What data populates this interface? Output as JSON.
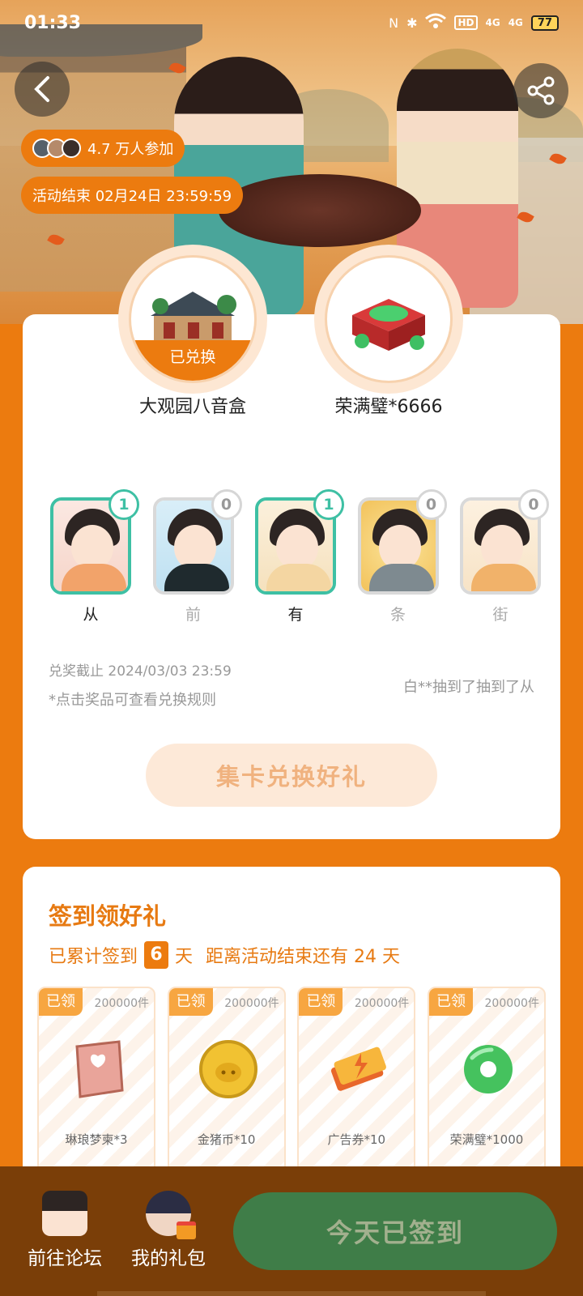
{
  "status_bar": {
    "time": "01:33",
    "nfc": "N",
    "bluetooth": "✱",
    "wifi": "wifi",
    "hd": "HD",
    "signal1": "4G",
    "signal2": "4G",
    "battery": "77"
  },
  "hero": {
    "participants": "4.7 万人参加",
    "end_time": "活动结束 02月24日 23:59:59"
  },
  "prizes": [
    {
      "name": "大观园八音盒",
      "status": "已兑换"
    },
    {
      "name": "荣满璧*6666",
      "status": ""
    }
  ],
  "cards": [
    {
      "label": "从",
      "count": "1",
      "collected": true,
      "cloth": "#f2a36a"
    },
    {
      "label": "前",
      "count": "0",
      "collected": false,
      "cloth": "#1f2a2e"
    },
    {
      "label": "有",
      "count": "1",
      "collected": true,
      "cloth": "#f4d6a2"
    },
    {
      "label": "条",
      "count": "0",
      "collected": false,
      "cloth": "#7e8a90"
    },
    {
      "label": "街",
      "count": "0",
      "collected": false,
      "cloth": "#f1b26a"
    }
  ],
  "info": {
    "deadline": "兑奖截止 2024/03/03 23:59",
    "hint": "*点击奖品可查看兑换规则",
    "ticker": "白**抽到了抽到了从"
  },
  "exchange_button": "集卡兑换好礼",
  "signin": {
    "title": "签到领好礼",
    "prefix": "已累计签到",
    "days": "6",
    "suffix": "天",
    "remaining": "距离活动结束还有 24 天",
    "rewards": [
      {
        "tag": "已领",
        "qty": "200000件",
        "name": "琳琅梦柬*3"
      },
      {
        "tag": "已领",
        "qty": "200000件",
        "name": "金猪币*10"
      },
      {
        "tag": "已领",
        "qty": "200000件",
        "name": "广告券*10"
      },
      {
        "tag": "已领",
        "qty": "200000件",
        "name": "荣满璧*1000"
      }
    ]
  },
  "bottom": {
    "forum": "前往论坛",
    "gifts": "我的礼包",
    "checkin": "今天已签到"
  },
  "colors": {
    "accent": "#ec7b0f",
    "teal": "#3ec0a4",
    "green_button": "#3f7d48"
  }
}
